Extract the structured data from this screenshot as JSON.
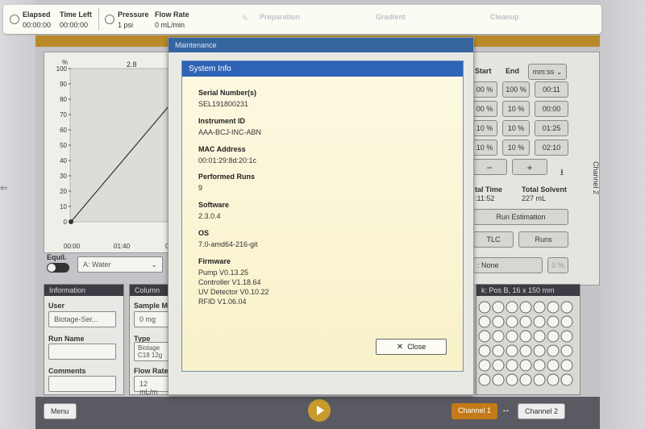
{
  "topbar": {
    "elapsed_label": "Elapsed",
    "elapsed_value": "00:00:00",
    "time_left_label": "Time Left",
    "time_left_value": "00:00:00",
    "pressure_label": "Pressure",
    "pressure_value": "1 psi",
    "flow_label": "Flow Rate",
    "flow_value": "0 mL/min",
    "steps": [
      "Preparation",
      "Gradient",
      "Cleanup"
    ]
  },
  "background": {
    "chart": {
      "y_unit": "%",
      "top_value": "2.8",
      "y_ticks": [
        "100",
        "90",
        "80",
        "70",
        "60",
        "50",
        "40",
        "30",
        "20",
        "10",
        "0"
      ],
      "x_ticks": [
        "00:00",
        "01:40",
        "0"
      ]
    },
    "equil_label": "Equil.",
    "solvent_select": "A: Water",
    "gradient": {
      "start_label": "Start",
      "end_label": "End",
      "unit_select": "mm:ss",
      "rows": [
        [
          "00 %",
          "100 %",
          "00:11"
        ],
        [
          "00 %",
          "10 %",
          "00:00"
        ],
        [
          "10 %",
          "10 %",
          "01:25"
        ],
        [
          "10 %",
          "10 %",
          "02:10"
        ]
      ]
    },
    "minus": "−",
    "plus": "+",
    "total_time_label": "tal Time",
    "total_time_value": ":11:52",
    "total_solvent_label": "Total Solvent",
    "total_solvent_value": "227 mL",
    "run_estimation": "Run Estimation",
    "tlc": "TLC",
    "runs": "Runs",
    "none_select": ": None",
    "zero_pct": "0 %",
    "rack_label": "k: Pos B, 16 x 150 mm",
    "info_head": "Information",
    "column_head": "Column",
    "user_label": "User",
    "user_value": "Biotage-Ser...",
    "run_name_label": "Run Name",
    "comments_label": "Comments",
    "sample_label": "Sample M",
    "sample_value": "0 mg",
    "type_label": "Type",
    "type_value": "Biotage\nC18 12g",
    "flow_label": "Flow Rate",
    "flow_value": "12 mL/m",
    "channel_side": "Channel 2"
  },
  "bottombar": {
    "menu": "Menu",
    "channel1": "Channel 1",
    "swap": "↔",
    "channel2": "Channel 2"
  },
  "modal": {
    "title": "Maintenance",
    "inner_title": "System Info",
    "fields": [
      {
        "label": "Serial Number(s)",
        "value": "SEL191800231"
      },
      {
        "label": "Instrument ID",
        "value": "AAA-BCJ-INC-ABN"
      },
      {
        "label": "MAC Address",
        "value": "00:01:29:8d:20:1c"
      },
      {
        "label": "Performed Runs",
        "value": "9"
      },
      {
        "label": "Software",
        "value": "2.3.0.4"
      },
      {
        "label": "OS",
        "value": "7.0-amd64-216-git"
      },
      {
        "label": "Firmware",
        "value": [
          "Pump V0.13.25",
          "Controller V1.18.64",
          "UV Detector V0.10.22",
          "RFID V1.06.04"
        ]
      }
    ],
    "close_label": "Close"
  },
  "colors": {
    "accent_orange": "#b88a2a",
    "header_blue": "#2f63b5",
    "modal_bg": "#f8f1c9"
  }
}
